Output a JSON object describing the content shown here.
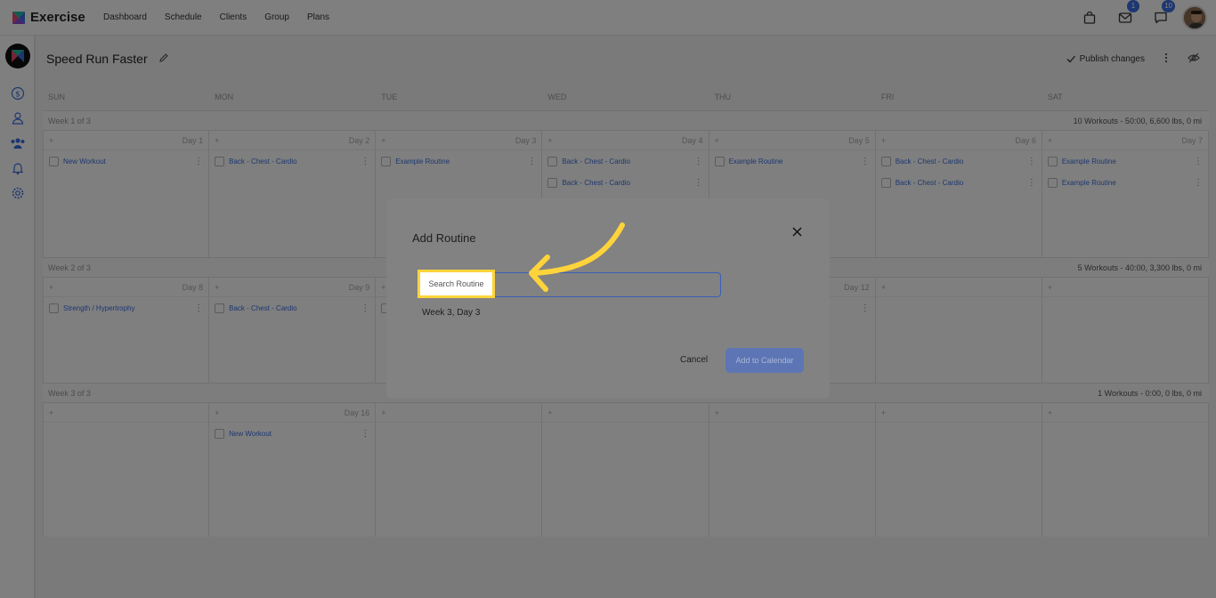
{
  "app": {
    "name": "Exercise"
  },
  "nav": [
    "Dashboard",
    "Schedule",
    "Clients",
    "Group",
    "Plans"
  ],
  "top_badges": {
    "mail": "1",
    "chat": "10"
  },
  "program": {
    "title": "Speed Run Faster",
    "publish_label": "Publish changes"
  },
  "days": [
    "SUN",
    "MON",
    "TUE",
    "WED",
    "THU",
    "FRI",
    "SAT"
  ],
  "weeks": [
    {
      "label": "Week 1 of 3",
      "stats": "10 Workouts - 50:00, 6,600 lbs, 0 mi",
      "day_labels": [
        "Day 1",
        "Day 2",
        "Day 3",
        "Day 4",
        "Day 5",
        "Day 6",
        "Day 7"
      ],
      "workouts": [
        [
          "New Workout"
        ],
        [
          "Back - Chest - Cardio"
        ],
        [
          "Example Routine"
        ],
        [
          "Back - Chest - Cardio",
          "Back - Chest - Cardio"
        ],
        [
          "Example Routine"
        ],
        [
          "Back - Chest - Cardio",
          "Back - Chest - Cardio"
        ],
        [
          "Example Routine",
          "Example Routine"
        ]
      ]
    },
    {
      "label": "Week 2 of 3",
      "stats": "5 Workouts - 40:00, 3,300 lbs, 0 mi",
      "day_labels": [
        "Day 8",
        "Day 9",
        "",
        "",
        "Day 12",
        "",
        ""
      ],
      "workouts": [
        [
          "Strength / Hypertrophy"
        ],
        [
          "Back - Chest - Cardio"
        ],
        [
          ""
        ],
        [],
        [
          ""
        ],
        [],
        []
      ]
    },
    {
      "label": "Week 3 of 3",
      "stats": "1 Workouts - 0:00, 0 lbs, 0 mi",
      "day_labels": [
        "",
        "Day 16",
        "",
        "",
        "",
        "",
        ""
      ],
      "workouts": [
        [],
        [
          "New Workout"
        ],
        [],
        [],
        [],
        [],
        []
      ]
    }
  ],
  "modal": {
    "title": "Add Routine",
    "search_placeholder": "Search Routine",
    "sub_label": "Week 3, Day 3",
    "cancel_label": "Cancel",
    "add_label": "Add to Calendar"
  },
  "colors": {
    "accent": "#3b6fe0",
    "highlight": "#ffd43b",
    "button": "#5d75b4"
  }
}
